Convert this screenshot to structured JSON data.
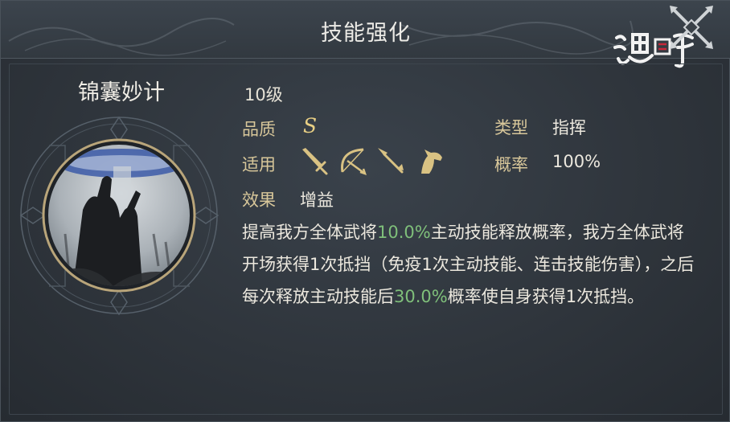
{
  "header": {
    "title": "技能强化"
  },
  "skill": {
    "name": "锦囊妙计",
    "level": "10级",
    "quality_label": "品质",
    "quality_value": "S",
    "type_label": "类型",
    "type_value": "指挥",
    "applicable_label": "适用",
    "applicable_icons": [
      "sword-icon",
      "bow-icon",
      "spear-icon",
      "horse-icon"
    ],
    "rate_label": "概率",
    "rate_value": "100%",
    "effect_label": "效果",
    "effect_value": "增益",
    "description": {
      "part1": "提高我方全体武将",
      "pct1": "10.0%",
      "part2": "主动技能释放概率，我方全体武将开场获得1次抵挡（免疫1次主动技能、连击技能伤害），之后每次释放主动技能后",
      "pct2": "30.0%",
      "part3": "概率使自身获得1次抵挡。"
    }
  },
  "colors": {
    "highlight": "#7fbf7a",
    "label": "#d8c79a",
    "grade": "#e8cf84"
  }
}
